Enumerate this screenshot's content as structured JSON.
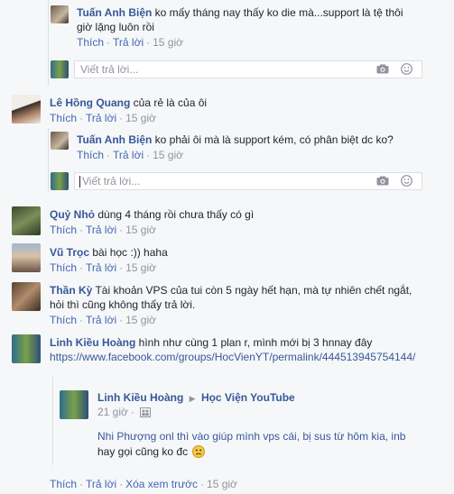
{
  "colors": {
    "link": "#365899",
    "action": "#4267b2",
    "meta": "#90949c",
    "border": "#dddfe2"
  },
  "comments": [
    {
      "name": "Tuấn Anh Biện",
      "text_line1": "ko mấy tháng nay thấy ko die mà...support là tệ thôi",
      "text_line2": "giờ lặng luôn rồi",
      "like": "Thích",
      "reply": "Trả lời",
      "time": "15 giờ"
    },
    {
      "name": "Lê Hồng Quang",
      "text": "của rẻ là của ôi",
      "like": "Thích",
      "reply": "Trả lời",
      "time": "15 giờ"
    },
    {
      "name": "Tuấn Anh Biện",
      "text": "ko phải ôi mà là support kém, có phân biệt dc ko?",
      "like": "Thích",
      "reply": "Trả lời",
      "time": "15 giờ"
    },
    {
      "name": "Quỷ Nhỏ",
      "text": "dùng 4 tháng rồi chưa thấy có gì",
      "like": "Thích",
      "reply": "Trả lời",
      "time": "15 giờ"
    },
    {
      "name": "Vũ Trọc",
      "text": "bài học :)) haha",
      "like": "Thích",
      "reply": "Trả lời",
      "time": "15 giờ"
    },
    {
      "name": "Thần Kỳ",
      "text_line1": "Tài khoản VPS của tui còn 5 ngày hết hạn, mà tự nhiên chết ngắt,",
      "text_line2": "hỏi thì cũng không thấy trả lời.",
      "like": "Thích",
      "reply": "Trả lời",
      "time": "15 giờ"
    },
    {
      "name": "Linh Kiều Hoàng",
      "text": "hình như cùng 1 plan r, mình mới bị 3 hnnay đây",
      "url": "https://www.facebook.com/groups/HocVienYT/permalink/444513945754144/"
    }
  ],
  "reply_placeholder": "Viết trả lời...",
  "shared_post": {
    "author": "Linh Kiều Hoàng",
    "arrow": "▶",
    "group": "Học Viện YouTube",
    "time": "21 giờ",
    "text_line1": "Nhi Phượng onl thì vào giúp mình vps cái, bị sus từ hôm kia, inb",
    "text_line2": "hay gọi cũng ko đc"
  },
  "footer": {
    "like": "Thích",
    "reply": "Trả lời",
    "hide_preview": "Xóa xem trước",
    "time": "15 giờ"
  }
}
